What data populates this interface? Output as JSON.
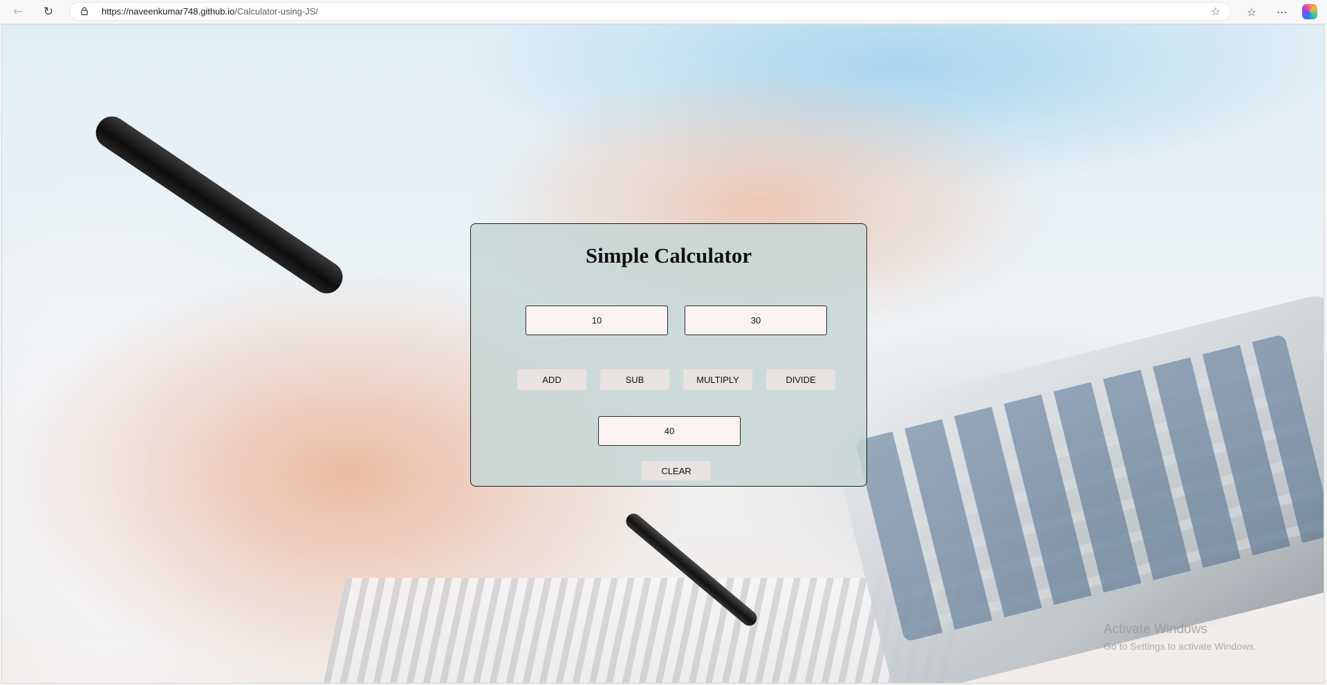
{
  "browser": {
    "url_host": "https://naveenkumar748.github.io",
    "url_path": "/Calculator-using-JS/",
    "icons": [
      "back-arrow-icon",
      "refresh-icon",
      "lock-icon",
      "star-icon",
      "favorites-icon",
      "more-icon",
      "copilot-icon"
    ]
  },
  "calculator": {
    "title": "Simple Calculator",
    "first_number": "10",
    "second_number": "30",
    "buttons": {
      "add": "ADD",
      "sub": "SUB",
      "multiply": "MULTIPLY",
      "divide": "DIVIDE",
      "clear": "CLEAR"
    },
    "result": "40"
  },
  "watermark": {
    "title": "Activate Windows",
    "subtitle": "Go to Settings to activate Windows."
  }
}
